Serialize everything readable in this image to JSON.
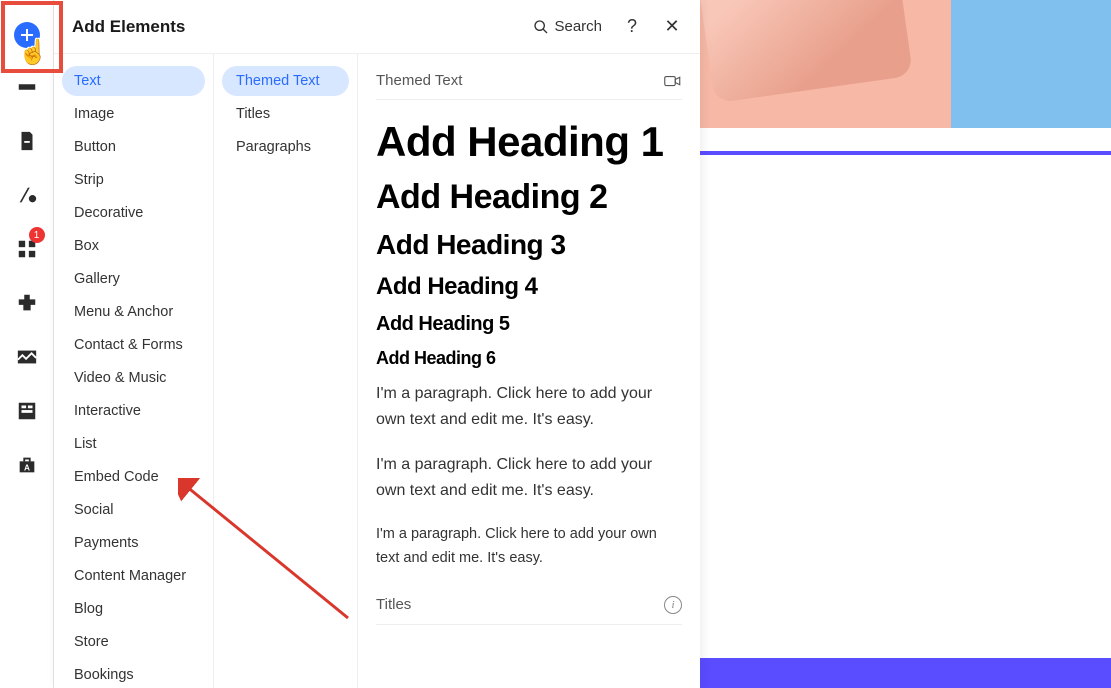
{
  "panel": {
    "title": "Add Elements",
    "search_label": "Search"
  },
  "rail_badge": "1",
  "categories": [
    "Text",
    "Image",
    "Button",
    "Strip",
    "Decorative",
    "Box",
    "Gallery",
    "Menu & Anchor",
    "Contact & Forms",
    "Video & Music",
    "Interactive",
    "List",
    "Embed Code",
    "Social",
    "Payments",
    "Content Manager",
    "Blog",
    "Store",
    "Bookings"
  ],
  "active_category": "Text",
  "subcategories": [
    "Themed Text",
    "Titles",
    "Paragraphs"
  ],
  "active_subcategory": "Themed Text",
  "sections": {
    "themed_text_label": "Themed Text",
    "titles_label": "Titles"
  },
  "headings": {
    "h1": "Add Heading 1",
    "h2": "Add Heading 2",
    "h3": "Add Heading 3",
    "h4": "Add Heading 4",
    "h5": "Add Heading 5",
    "h6": "Add Heading 6"
  },
  "paragraphs": {
    "p1": "I'm a paragraph. Click here to add your own text and edit me. It's easy.",
    "p2": "I'm a paragraph. Click here to add your own text and edit me. It's easy.",
    "p3": "I'm a paragraph. Click here to add your own text and edit me. It's easy."
  }
}
